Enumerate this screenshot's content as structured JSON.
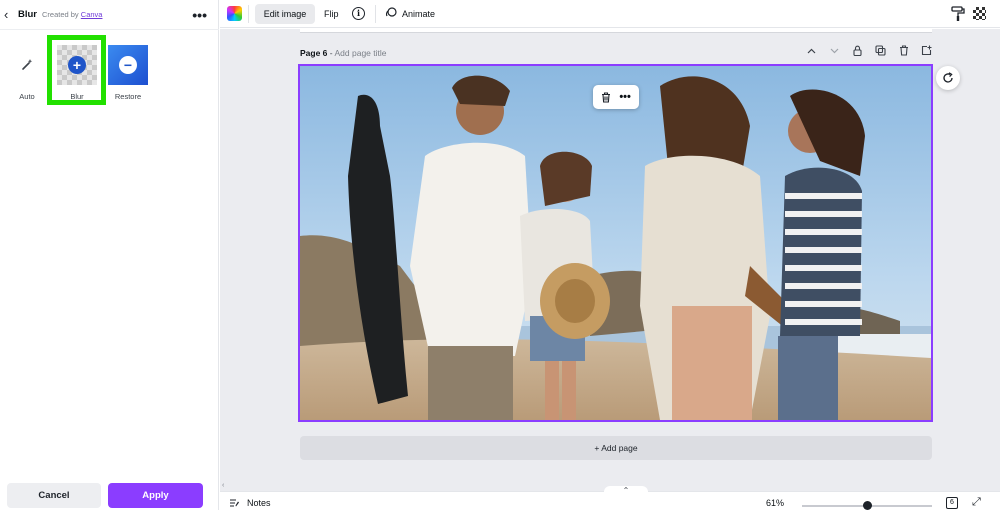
{
  "left_panel": {
    "back_glyph": "‹",
    "title": "Blur",
    "created_prefix": "Created by",
    "created_link": "Canva",
    "more_glyph": "•••",
    "tools": [
      {
        "label": "Auto",
        "icon": "magic-wand-icon"
      },
      {
        "label": "Blur",
        "icon": "plus-circle-icon",
        "selected": true
      },
      {
        "label": "Restore",
        "icon": "minus-circle-icon"
      }
    ],
    "cancel_label": "Cancel",
    "apply_label": "Apply"
  },
  "toolbar": {
    "edit_image_label": "Edit image",
    "flip_label": "Flip",
    "info_glyph": "i",
    "animate_label": "Animate"
  },
  "canvas": {
    "page_number": "Page 6",
    "page_separator": " - ",
    "page_title_placeholder": "Add page title",
    "context_menu_more": "•••",
    "add_page_label": "+ Add page"
  },
  "bottom_bar": {
    "collapse_glyph": "⌃",
    "notes_label": "Notes",
    "zoom_label": "61%",
    "zoom_fraction": 0.61,
    "page_count": "6",
    "expand_glyph": "⤢"
  },
  "colors": {
    "accent": "#8b3dff",
    "highlight": "#22e000",
    "restore_blue": "#1f55c9"
  }
}
